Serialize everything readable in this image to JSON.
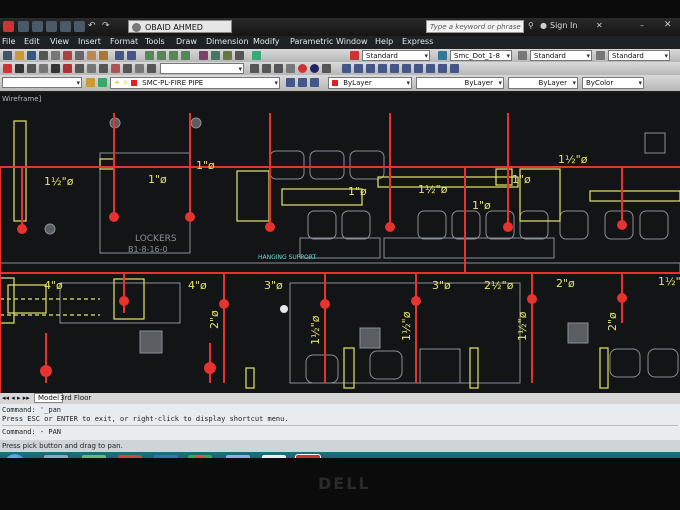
{
  "window": {
    "user": "OBAID AHMED",
    "search_placeholder": "Type a keyword or phrase",
    "sign_in": "Sign In"
  },
  "menu": [
    "File",
    "Edit",
    "View",
    "Insert",
    "Format",
    "Tools",
    "Draw",
    "Dimension",
    "Modify",
    "Parametric",
    "Window",
    "Help",
    "Express"
  ],
  "toolbar": {
    "text_style": "Standard",
    "dim_style": "Smc_Dot_1-8",
    "table_style": "Standard",
    "multileader_style": "Standard",
    "layer": "SMC-PL-FIRE PIPE",
    "color": "ByLayer",
    "linetype": "ByLayer",
    "lineweight": "ByLayer",
    "plot_style": "ByColor"
  },
  "viewport_label": "Wireframe]",
  "drawing": {
    "labels": {
      "lockers": "LOCKERS",
      "lockers_code": "B1-8-16-0",
      "hanging_support": "HANGING SUPPORT",
      "d_1_1_2_a": "1½\"ø",
      "d_1_b": "1\"ø",
      "d_1_c": "1\"ø",
      "d_1_d": "1\"ø",
      "d_1_1_2_e": "1½\"ø",
      "d_1_f": "1\"ø",
      "d_1_1_2_g": "1½\"ø",
      "d_1_h": "1\"ø",
      "d_4_a": "4\"ø",
      "d_4_b": "4\"ø",
      "d_3_a": "3\"ø",
      "d_3_b": "3\"ø",
      "d_2_1_2": "2½\"ø",
      "d_2_a": "2\"ø",
      "d_1_1_2_r": "1½\"",
      "d_2_v": "2\"ø",
      "d_1_1_2_v1": "1½\"ø",
      "d_1_1_2_v2": "1½\"ø",
      "d_1_1_2_v3": "1½\"ø",
      "d_2_v2": "2\"ø"
    }
  },
  "layout_tabs": [
    "Model",
    "3rd Floor"
  ],
  "command": {
    "line1": "Command: '_pan",
    "line2": "Press ESC or ENTER to exit, or right-click to display shortcut menu.",
    "line3": "Command: - PAN"
  },
  "status_text": "Press pick button and drag to pan.",
  "taskbar": {
    "apps": [
      "explorer",
      "file-manager",
      "exchange",
      "media-player",
      "firefox",
      "chrome",
      "paint",
      "documents",
      "autocad"
    ]
  },
  "brand": "DELL",
  "colors": {
    "pipe": "#e8322e",
    "text": "#e6e66a",
    "furniture": "#8a8f96",
    "cyan_text": "#60e0d0"
  }
}
